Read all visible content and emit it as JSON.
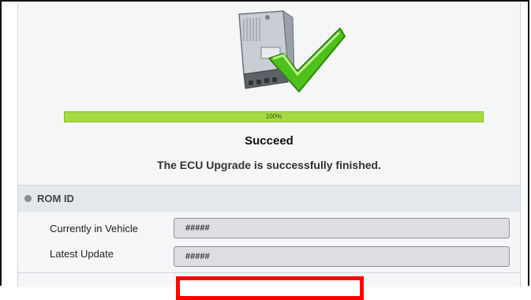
{
  "progress": {
    "percent_label": "100%",
    "fraction": 1.0
  },
  "status": {
    "title": "Succeed",
    "message": "The ECU Upgrade is successfully finished."
  },
  "rom_id": {
    "section_label": "ROM ID",
    "rows": [
      {
        "label": "Currently in Vehicle",
        "value": "#####"
      },
      {
        "label": "Latest Update",
        "value": "#####"
      }
    ]
  },
  "icons": {
    "ecu": "ecu-module-icon",
    "check": "checkmark-icon"
  },
  "colors": {
    "progress_green": "#a6da45",
    "check_green": "#4fbf1c",
    "highlight_red": "#ff0000"
  }
}
